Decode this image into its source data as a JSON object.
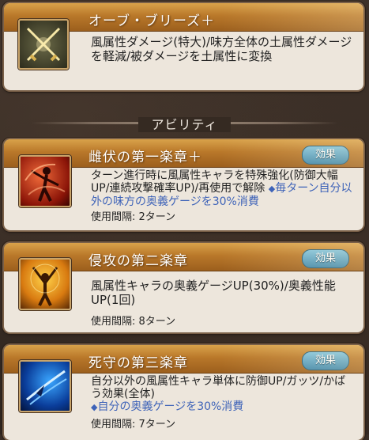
{
  "summon": {
    "title": "オーブ・ブリーズ＋",
    "icon": "crossed-swords-icon",
    "desc": "風属性ダメージ(特大)/味方全体の土属性ダメージを軽減/被ダメージを土属性に変換"
  },
  "section": {
    "label": "アビリティ"
  },
  "abilities": [
    {
      "title": "雌伏の第一楽章＋",
      "button": "効果",
      "icon": "conductor-icon",
      "desc": "ターン進行時に風属性キャラを特殊強化(防御大幅UP/連続攻撃確率UP)/再使用で解除",
      "note": "毎ターン自分以外の味方の奥義ゲージを30%消費",
      "bullet": "◆",
      "interval": "使用間隔: 2ターン"
    },
    {
      "title": "侵攻の第二楽章",
      "button": "効果",
      "icon": "raised-arms-icon",
      "desc": "風属性キャラの奥義ゲージUP(30%)/奥義性能UP(1回)",
      "interval": "使用間隔: 8ターン"
    },
    {
      "title": "死守の第三楽章",
      "button": "効果",
      "icon": "blue-slash-icon",
      "desc": "自分以外の風属性キャラ単体に防御UP/ガッツ/かばう効果(全体)",
      "note": "自分の奥義ゲージを30%消費",
      "bullet": "◆",
      "interval": "使用間隔: 7ターン"
    }
  ],
  "colors": {
    "header_gold": "#b9782a",
    "panel_bg": "#ede6dc",
    "note_blue": "#3e63b8",
    "button_blue": "#3a86ad"
  }
}
